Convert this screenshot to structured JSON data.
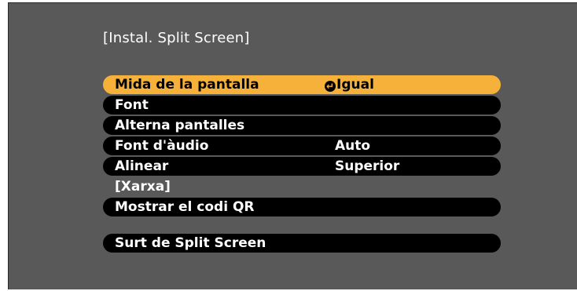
{
  "title": "[Instal. Split Screen]",
  "menu": {
    "items": [
      {
        "label": "Mida de la pantalla",
        "value": "Igual",
        "selected": true
      },
      {
        "label": "Font",
        "value": ""
      },
      {
        "label": "Alterna pantalles",
        "value": ""
      },
      {
        "label": "Font d'àudio",
        "value": "Auto"
      },
      {
        "label": "Alinear",
        "value": "Superior"
      }
    ],
    "network_section": "[Xarxa]",
    "qr_label": "Mostrar el codi QR",
    "exit_label": "Surt de Split Screen"
  },
  "colors": {
    "background": "#595959",
    "row": "#000000",
    "highlight": "#f5b13a",
    "text": "#ffffff"
  },
  "icons": {
    "enter": "enter-icon"
  }
}
